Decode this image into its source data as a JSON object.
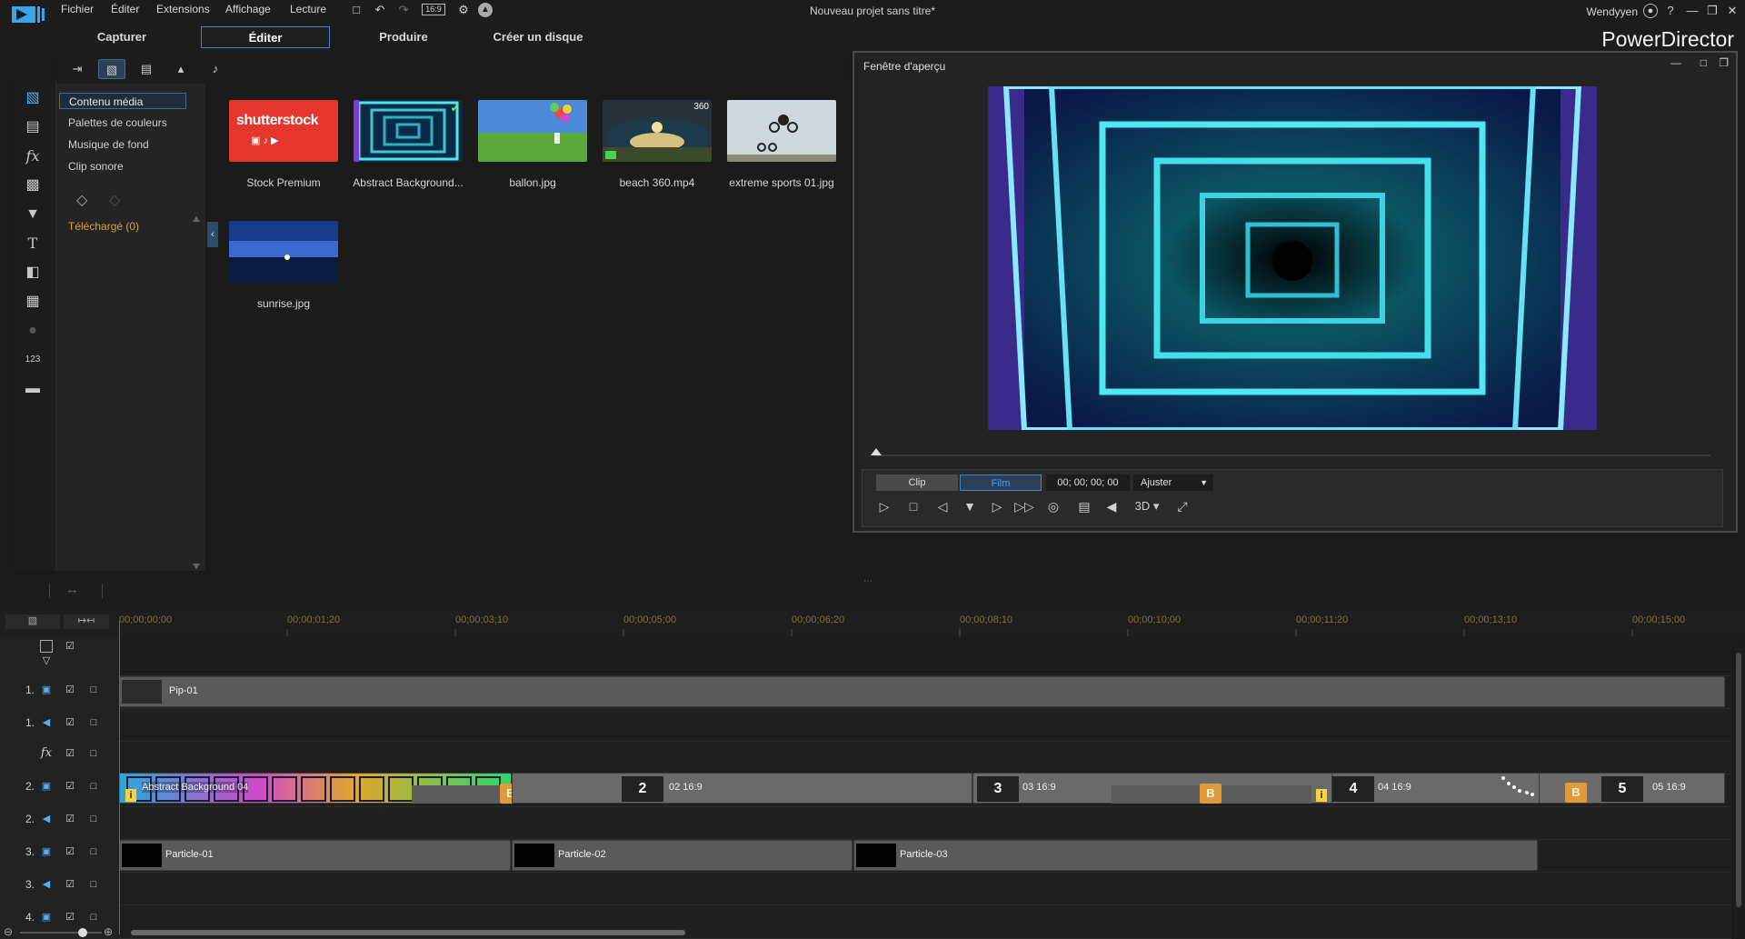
{
  "app": {
    "window_title": "Nouveau projet sans titre*",
    "user": "Wendyyen",
    "brand": "PowerDirector",
    "accent": "#3a87cf",
    "menu": [
      "Fichier",
      "Éditer",
      "Extensions",
      "Affichage",
      "Lecture"
    ],
    "aspect_ratio": "16:9"
  },
  "modes": {
    "tabs": [
      {
        "label": "Capturer",
        "active": false
      },
      {
        "label": "Éditer",
        "active": true
      },
      {
        "label": "Produire",
        "active": false
      },
      {
        "label": "Créer un disque",
        "active": false
      }
    ]
  },
  "library": {
    "nav": [
      {
        "label": "Contenu média",
        "active": true
      },
      {
        "label": "Palettes de couleurs",
        "active": false
      },
      {
        "label": "Musique de fond",
        "active": false
      },
      {
        "label": "Clip sonore",
        "active": false
      }
    ],
    "downloaded": "Téléchargé  (0)",
    "items": [
      {
        "label": "Stock Premium",
        "icon": "shutterstock-logo",
        "logo_text": "shutterstock"
      },
      {
        "label": "Abstract Background...",
        "checked": true
      },
      {
        "label": "ballon.jpg"
      },
      {
        "label": "beach 360.mp4",
        "badge": "360"
      },
      {
        "label": "extreme sports 01.jpg"
      },
      {
        "label": "sunrise.jpg"
      }
    ]
  },
  "preview": {
    "title": "Fenêtre d'aperçu",
    "mode_clip": "Clip",
    "mode_film": "Film",
    "active_mode": "Film",
    "timecode": "00; 00; 00; 00",
    "fit": "Ajuster",
    "three_d": "3D"
  },
  "timeline": {
    "ruler": [
      "00;00;00;00",
      "00;00;01;20",
      "00;00;03;10",
      "00;00;05;00",
      "00;00;06;20",
      "00;00;08;10",
      "00;00;10;00",
      "00;00;11;20",
      "00;00;13;10",
      "00;00;15;00"
    ],
    "tracks": [
      {
        "num": "1.",
        "kind": "video"
      },
      {
        "num": "1.",
        "kind": "audio"
      },
      {
        "num": "",
        "kind": "fx"
      },
      {
        "num": "2.",
        "kind": "video"
      },
      {
        "num": "2.",
        "kind": "audio"
      },
      {
        "num": "3.",
        "kind": "video"
      },
      {
        "num": "3.",
        "kind": "audio"
      },
      {
        "num": "4.",
        "kind": "video"
      }
    ],
    "clips": {
      "pip": "Pip-01",
      "main": "Abstract Background 04",
      "countdown": [
        {
          "num": "2",
          "label": "02 16:9"
        },
        {
          "num": "3",
          "label": "03 16:9"
        },
        {
          "num": "4",
          "label": "04 16:9"
        },
        {
          "num": "5",
          "label": "05 16:9"
        }
      ],
      "particles": [
        "Particle-01",
        "Particle-02",
        "Particle-03"
      ]
    },
    "transition_icon": "B"
  }
}
